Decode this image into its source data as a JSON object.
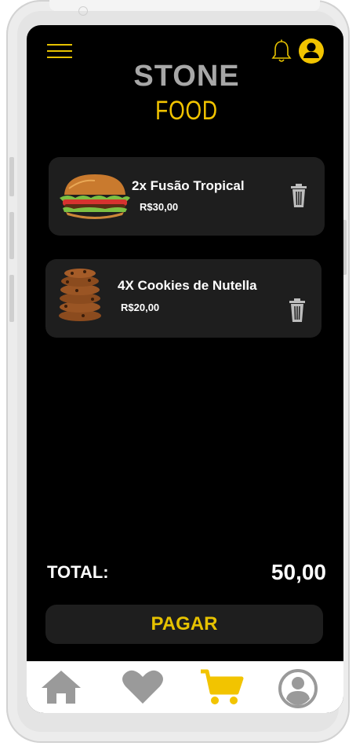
{
  "header": {
    "brand_line1": "STONE",
    "brand_line2": "FOOD",
    "icons": [
      "menu-icon",
      "bell-icon",
      "user-profile-icon"
    ]
  },
  "cart": {
    "items": [
      {
        "name": "2x Fusão Tropical",
        "price": "R$30,00",
        "image": "burger-image",
        "action_icon": "trash-icon"
      },
      {
        "name": "4X Cookies de Nutella",
        "price": "R$20,00",
        "image": "cookies-image",
        "action_icon": "trash-icon"
      }
    ]
  },
  "summary": {
    "total_label": "TOTAL:",
    "total_value": "50,00",
    "pay_label": "PAGAR"
  },
  "bottom_nav": {
    "items": [
      "home-icon",
      "heart-icon",
      "cart-icon",
      "profile-icon"
    ],
    "active": "cart-icon"
  },
  "colors": {
    "background": "#000000",
    "accent": "#E6C200",
    "card": "#1E1E1E",
    "brand_gray": "#A7A7A7",
    "nav_inactive": "#A0A0A0"
  }
}
